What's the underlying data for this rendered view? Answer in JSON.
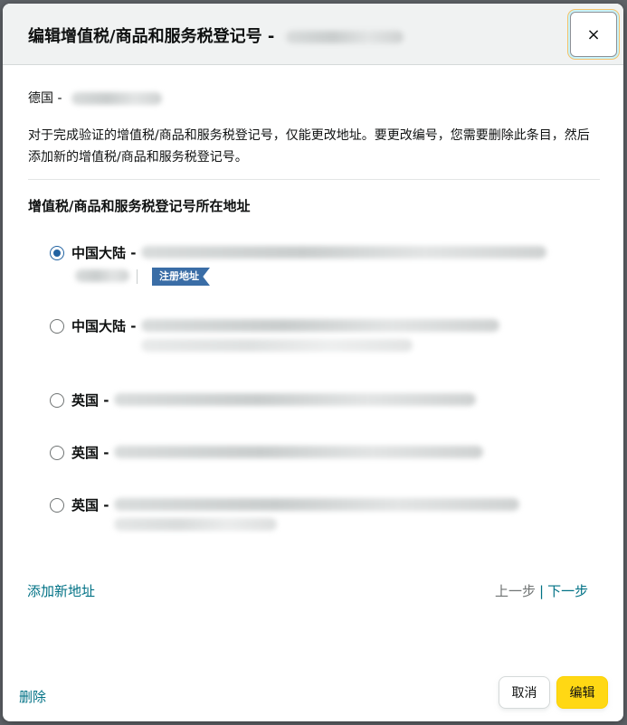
{
  "modal": {
    "title": "编辑增值税/商品和服务税登记号 -",
    "close_label": "×"
  },
  "details": {
    "country_prefix": "德国 -",
    "notice": "对于完成验证的增值税/商品和服务税登记号，仅能更改地址。要更改编号，您需要删除此条目，然后添加新的增值税/商品和服务税登记号。",
    "section_title": "增值税/商品和服务税登记号所在地址"
  },
  "addresses": [
    {
      "label": "中国大陆 -",
      "selected": true,
      "badge": "注册地址"
    },
    {
      "label": "中国大陆 -",
      "selected": false
    },
    {
      "label": "英国 -",
      "selected": false
    },
    {
      "label": "英国 -",
      "selected": false
    },
    {
      "label": "英国 -",
      "selected": false
    }
  ],
  "footer": {
    "add_address": "添加新地址",
    "prev": "上一步",
    "separator": "|",
    "next": "下一步",
    "delete": "删除",
    "cancel": "取消",
    "edit": "编辑"
  },
  "colors": {
    "link": "#007185",
    "primary_button": "#ffd814",
    "badge": "#3a6da6",
    "radio_checked": "#2162a1"
  }
}
